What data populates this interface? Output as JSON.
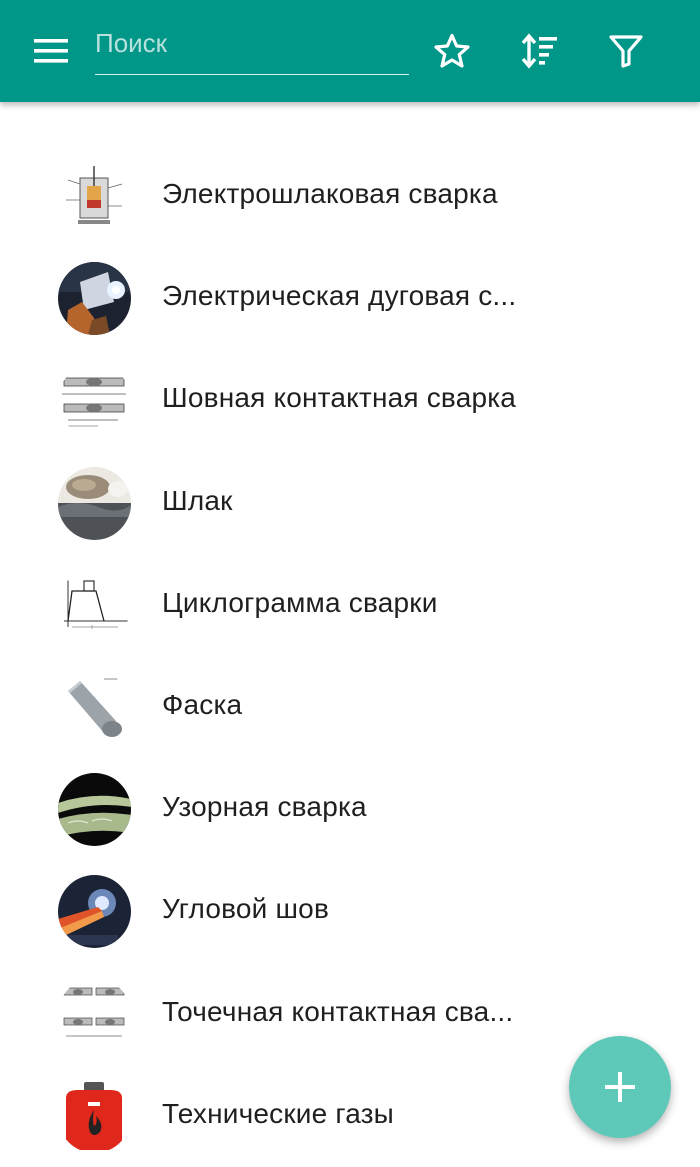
{
  "colors": {
    "appbar": "#009688",
    "fab": "#5ec8b9",
    "text_primary": "#1f1f1f"
  },
  "toolbar": {
    "menu_icon": "menu-icon",
    "search": {
      "value": "",
      "placeholder": "Поиск"
    },
    "actions": [
      {
        "name": "favorites",
        "icon": "star-icon"
      },
      {
        "name": "sort",
        "icon": "sort-icon"
      },
      {
        "name": "filter",
        "icon": "filter-icon"
      }
    ]
  },
  "list": {
    "items": [
      {
        "label": "Электрошлаковая сварка",
        "thumbnail": "electroslag-diagram"
      },
      {
        "label": "Электрическая дуговая с...",
        "thumbnail": "arc-welding-photo"
      },
      {
        "label": "Шовная контактная сварка",
        "thumbnail": "seam-welding-diagram"
      },
      {
        "label": "Шлак",
        "thumbnail": "slag-photo"
      },
      {
        "label": "Циклограмма сварки",
        "thumbnail": "cyclogram-chart"
      },
      {
        "label": "Фаска",
        "thumbnail": "chamfer-drawing"
      },
      {
        "label": "Узорная сварка",
        "thumbnail": "pattern-weld-photo"
      },
      {
        "label": "Угловой шов",
        "thumbnail": "fillet-weld-photo"
      },
      {
        "label": "Точечная контактная сва...",
        "thumbnail": "spot-welding-diagram"
      },
      {
        "label": "Технические газы",
        "thumbnail": "gas-canister-photo"
      }
    ]
  },
  "fab": {
    "icon": "plus-icon"
  }
}
